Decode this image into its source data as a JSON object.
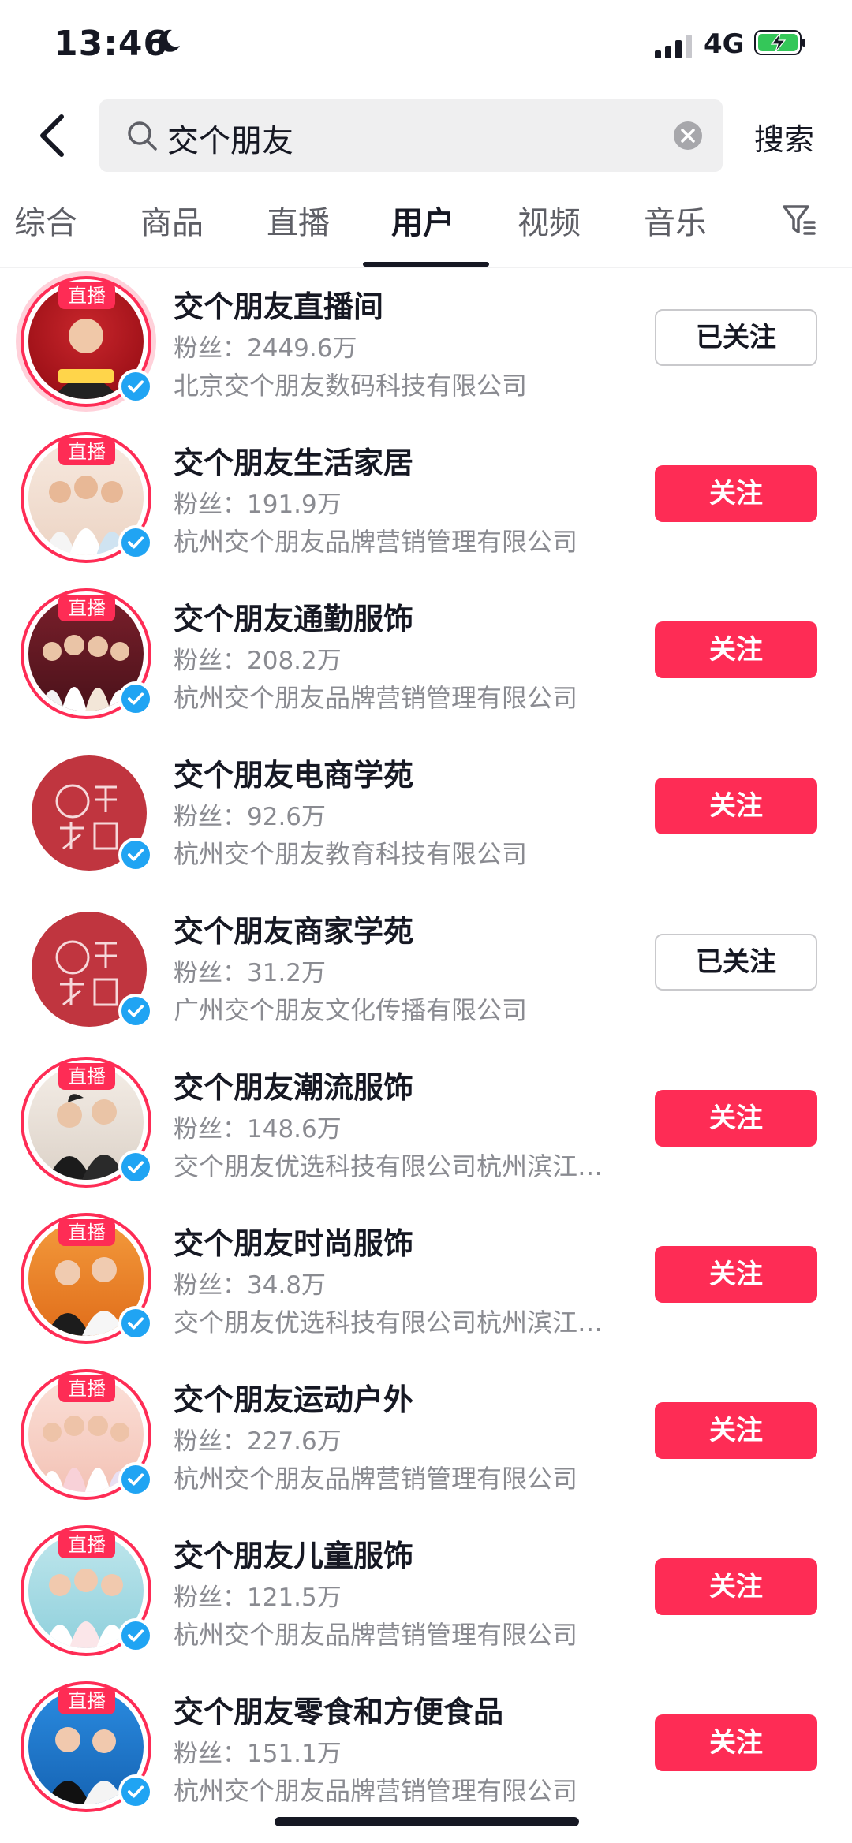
{
  "status_bar": {
    "time": "13:46",
    "network": "4G",
    "icons": [
      "moon-icon",
      "signal-icon",
      "battery-charging-icon"
    ]
  },
  "search": {
    "query": "交个朋友",
    "submit_label": "搜索",
    "icons": [
      "back-chevron-icon",
      "search-icon",
      "clear-icon"
    ]
  },
  "tabs": {
    "items": [
      "综合",
      "商品",
      "直播",
      "用户",
      "视频",
      "音乐"
    ],
    "active": "用户",
    "filter_icon": "filter-icon"
  },
  "users": [
    {
      "name": "交个朋友直播间",
      "fans": "粉丝：2449.6万",
      "company": "北京交个朋友数码科技有限公司",
      "live": true,
      "live_label": "直播",
      "follow_label": "已关注",
      "followed": true
    },
    {
      "name": "交个朋友生活家居",
      "fans": "粉丝：191.9万",
      "company": "杭州交个朋友品牌营销管理有限公司",
      "live": true,
      "live_label": "直播",
      "follow_label": "关注",
      "followed": false
    },
    {
      "name": "交个朋友通勤服饰",
      "fans": "粉丝：208.2万",
      "company": "杭州交个朋友品牌营销管理有限公司",
      "live": true,
      "live_label": "直播",
      "follow_label": "关注",
      "followed": false
    },
    {
      "name": "交个朋友电商学苑",
      "fans": "粉丝：92.6万",
      "company": "杭州交个朋友教育科技有限公司",
      "live": false,
      "live_label": "",
      "follow_label": "关注",
      "followed": false
    },
    {
      "name": "交个朋友商家学苑",
      "fans": "粉丝：31.2万",
      "company": "广州交个朋友文化传播有限公司",
      "live": false,
      "live_label": "",
      "follow_label": "已关注",
      "followed": true
    },
    {
      "name": "交个朋友潮流服饰",
      "fans": "粉丝：148.6万",
      "company": "交个朋友优选科技有限公司杭州滨江…",
      "live": true,
      "live_label": "直播",
      "follow_label": "关注",
      "followed": false
    },
    {
      "name": "交个朋友时尚服饰",
      "fans": "粉丝：34.8万",
      "company": "交个朋友优选科技有限公司杭州滨江…",
      "live": true,
      "live_label": "直播",
      "follow_label": "关注",
      "followed": false
    },
    {
      "name": "交个朋友运动户外",
      "fans": "粉丝：227.6万",
      "company": "杭州交个朋友品牌营销管理有限公司",
      "live": true,
      "live_label": "直播",
      "follow_label": "关注",
      "followed": false
    },
    {
      "name": "交个朋友儿童服饰",
      "fans": "粉丝：121.5万",
      "company": "杭州交个朋友品牌营销管理有限公司",
      "live": true,
      "live_label": "直播",
      "follow_label": "关注",
      "followed": false
    },
    {
      "name": "交个朋友零食和方便食品",
      "fans": "粉丝：151.1万",
      "company": "杭州交个朋友品牌营销管理有限公司",
      "live": true,
      "live_label": "直播",
      "follow_label": "关注",
      "followed": false
    }
  ],
  "colors": {
    "accent": "#fe2c55",
    "verified": "#20a4f3",
    "text_primary": "#161823",
    "text_secondary": "#8a8b91"
  }
}
